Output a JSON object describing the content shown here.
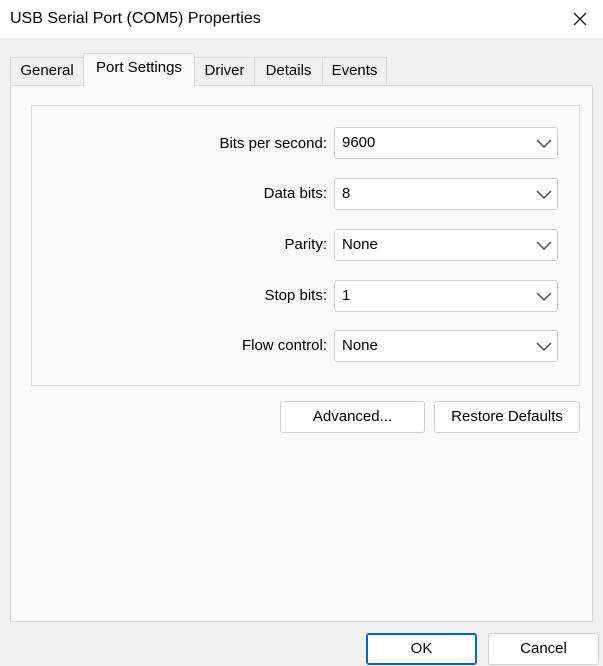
{
  "window": {
    "title": "USB Serial Port (COM5) Properties"
  },
  "tabs": [
    {
      "label": "General",
      "active": false
    },
    {
      "label": "Port Settings",
      "active": true
    },
    {
      "label": "Driver",
      "active": false
    },
    {
      "label": "Details",
      "active": false
    },
    {
      "label": "Events",
      "active": false
    }
  ],
  "port_settings": {
    "fields": [
      {
        "label": "Bits per second:",
        "value": "9600"
      },
      {
        "label": "Data bits:",
        "value": "8"
      },
      {
        "label": "Parity:",
        "value": "None"
      },
      {
        "label": "Stop bits:",
        "value": "1"
      },
      {
        "label": "Flow control:",
        "value": "None"
      }
    ],
    "advanced_label": "Advanced...",
    "restore_label": "Restore Defaults"
  },
  "footer": {
    "ok_label": "OK",
    "cancel_label": "Cancel"
  },
  "icons": {
    "close": "close-icon",
    "dropdown": "chevron-down-icon"
  },
  "colors": {
    "accent": "#0067c0",
    "window_bg": "#f0f0f0",
    "pane_bg": "#f9f9f9"
  }
}
